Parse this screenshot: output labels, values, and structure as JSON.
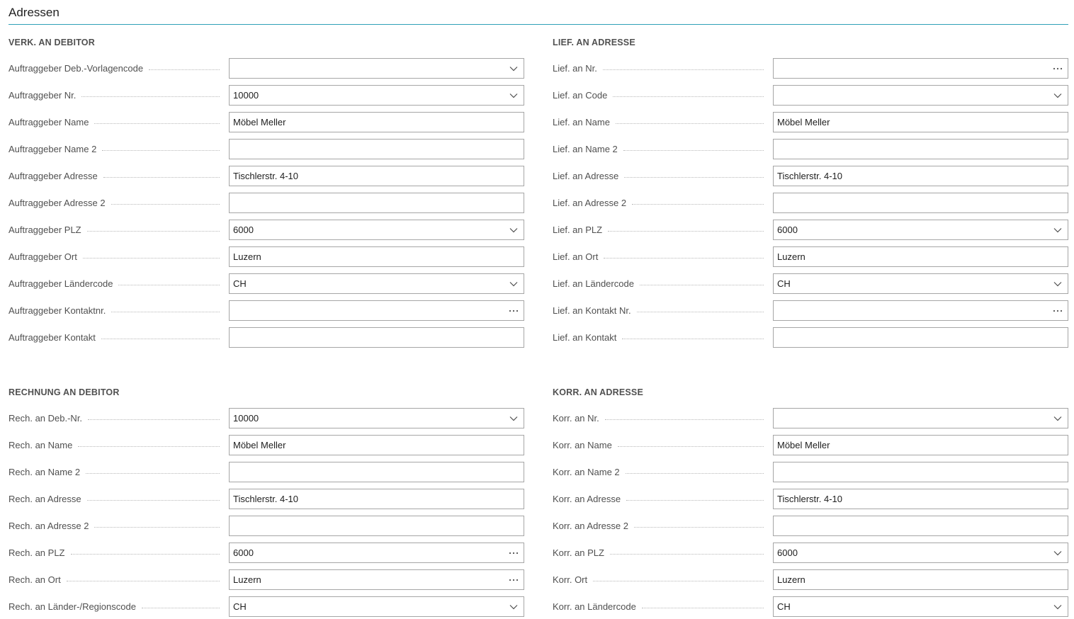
{
  "page": {
    "title": "Adressen",
    "accent": "#2fa0b8"
  },
  "groups": [
    {
      "title": "VERK. AN DEBITOR",
      "fields": [
        {
          "label": "Auftraggeber Deb.-Vorlagencode",
          "value": "",
          "control": "dropdown"
        },
        {
          "label": "Auftraggeber Nr.",
          "value": "10000",
          "control": "dropdown"
        },
        {
          "label": "Auftraggeber Name",
          "value": "Möbel Meller",
          "control": "text"
        },
        {
          "label": "Auftraggeber Name 2",
          "value": "",
          "control": "text"
        },
        {
          "label": "Auftraggeber Adresse",
          "value": "Tischlerstr. 4-10",
          "control": "text"
        },
        {
          "label": "Auftraggeber Adresse 2",
          "value": "",
          "control": "text"
        },
        {
          "label": "Auftraggeber PLZ",
          "value": "6000",
          "control": "dropdown"
        },
        {
          "label": "Auftraggeber Ort",
          "value": "Luzern",
          "control": "text"
        },
        {
          "label": "Auftraggeber Ländercode",
          "value": "CH",
          "control": "dropdown"
        },
        {
          "label": "Auftraggeber Kontaktnr.",
          "value": "",
          "control": "lookup"
        },
        {
          "label": "Auftraggeber Kontakt",
          "value": "",
          "control": "text"
        }
      ]
    },
    {
      "title": "LIEF. AN ADRESSE",
      "fields": [
        {
          "label": "Lief. an Nr.",
          "value": "",
          "control": "lookup"
        },
        {
          "label": "Lief. an Code",
          "value": "",
          "control": "dropdown"
        },
        {
          "label": "Lief. an Name",
          "value": "Möbel Meller",
          "control": "text"
        },
        {
          "label": "Lief. an Name 2",
          "value": "",
          "control": "text"
        },
        {
          "label": "Lief. an Adresse",
          "value": "Tischlerstr. 4-10",
          "control": "text"
        },
        {
          "label": "Lief. an Adresse 2",
          "value": "",
          "control": "text"
        },
        {
          "label": "Lief. an PLZ",
          "value": "6000",
          "control": "dropdown"
        },
        {
          "label": "Lief. an Ort",
          "value": "Luzern",
          "control": "text"
        },
        {
          "label": "Lief. an Ländercode",
          "value": "CH",
          "control": "dropdown"
        },
        {
          "label": "Lief. an Kontakt Nr.",
          "value": "",
          "control": "lookup"
        },
        {
          "label": "Lief. an Kontakt",
          "value": "",
          "control": "text"
        }
      ]
    },
    {
      "title": "RECHNUNG AN DEBITOR",
      "fields": [
        {
          "label": "Rech. an Deb.-Nr.",
          "value": "10000",
          "control": "dropdown"
        },
        {
          "label": "Rech. an Name",
          "value": "Möbel Meller",
          "control": "text"
        },
        {
          "label": "Rech. an Name 2",
          "value": "",
          "control": "text"
        },
        {
          "label": "Rech. an Adresse",
          "value": "Tischlerstr. 4-10",
          "control": "text"
        },
        {
          "label": "Rech. an Adresse 2",
          "value": "",
          "control": "text"
        },
        {
          "label": "Rech. an PLZ",
          "value": "6000",
          "control": "lookup"
        },
        {
          "label": "Rech. an Ort",
          "value": "Luzern",
          "control": "lookup"
        },
        {
          "label": "Rech. an Länder-/Regionscode",
          "value": "CH",
          "control": "dropdown"
        }
      ]
    },
    {
      "title": "KORR. AN ADRESSE",
      "fields": [
        {
          "label": "Korr. an Nr.",
          "value": "",
          "control": "dropdown"
        },
        {
          "label": "Korr. an Name",
          "value": "Möbel Meller",
          "control": "text"
        },
        {
          "label": "Korr. an Name 2",
          "value": "",
          "control": "text"
        },
        {
          "label": "Korr. an Adresse",
          "value": "Tischlerstr. 4-10",
          "control": "text"
        },
        {
          "label": "Korr. an Adresse 2",
          "value": "",
          "control": "text"
        },
        {
          "label": "Korr. an PLZ",
          "value": "6000",
          "control": "dropdown"
        },
        {
          "label": "Korr. Ort",
          "value": "Luzern",
          "control": "text"
        },
        {
          "label": "Korr. an Ländercode",
          "value": "CH",
          "control": "dropdown"
        }
      ]
    }
  ]
}
